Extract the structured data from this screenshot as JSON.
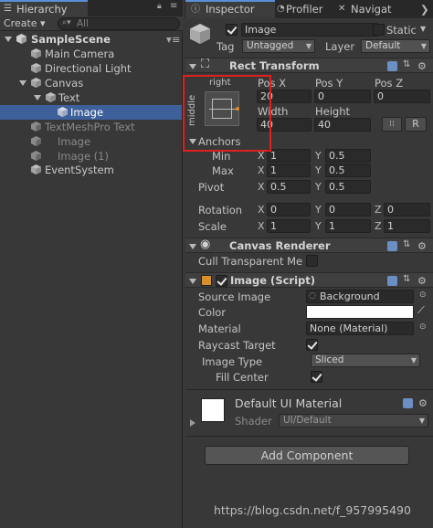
{
  "hierarchy": {
    "tab_label": "Hierarchy",
    "create_label": "Create ▾",
    "search_placeholder": "All",
    "scene": "SampleScene",
    "items": [
      {
        "label": "Main Camera"
      },
      {
        "label": "Directional Light"
      },
      {
        "label": "Canvas"
      },
      {
        "label": "Text"
      },
      {
        "label": "Image"
      },
      {
        "label": "TextMeshPro Text"
      },
      {
        "label": "Image"
      },
      {
        "label": "Image (1)"
      },
      {
        "label": "EventSystem"
      }
    ]
  },
  "tabs": {
    "inspector": "Inspector",
    "profiler": "Profiler",
    "navigation": "Navigat"
  },
  "object": {
    "name": "Image",
    "static_label": "Static",
    "tag_label": "Tag",
    "tag_value": "Untagged",
    "layer_label": "Layer",
    "layer_value": "Default"
  },
  "rect_transform": {
    "title": "Rect Transform",
    "anchor_h": "right",
    "anchor_v": "middle",
    "pos_x_label": "Pos X",
    "pos_y_label": "Pos Y",
    "pos_z_label": "Pos Z",
    "pos_x": "20",
    "pos_y": "0",
    "pos_z": "0",
    "width_label": "Width",
    "height_label": "Height",
    "width": "40",
    "height": "40",
    "r_button": "R",
    "anchors_label": "Anchors",
    "min_label": "Min",
    "max_label": "Max",
    "min_x": "1",
    "min_y": "0.5",
    "max_x": "1",
    "max_y": "0.5",
    "pivot_label": "Pivot",
    "pivot_x": "0.5",
    "pivot_y": "0.5",
    "rotation_label": "Rotation",
    "rot_x": "0",
    "rot_y": "0",
    "rot_z": "0",
    "scale_label": "Scale",
    "scale_x": "1",
    "scale_y": "1",
    "scale_z": "1",
    "x": "X",
    "y": "Y",
    "z": "Z"
  },
  "canvas_renderer": {
    "title": "Canvas Renderer",
    "cull_label": "Cull Transparent Me"
  },
  "image_script": {
    "title": "Image (Script)",
    "source_label": "Source Image",
    "source_value": "Background",
    "color_label": "Color",
    "material_label": "Material",
    "material_value": "None (Material)",
    "raycast_label": "Raycast Target",
    "type_label": "Image Type",
    "type_value": "Sliced",
    "fill_label": "Fill Center"
  },
  "material": {
    "name": "Default UI Material",
    "shader_label": "Shader",
    "shader_value": "UI/Default"
  },
  "add_component": "Add Component",
  "watermark": "https://blog.csdn.net/f_957995490",
  "colors": {
    "highlight_box": "#e0201c",
    "selection": "#3d609b"
  }
}
